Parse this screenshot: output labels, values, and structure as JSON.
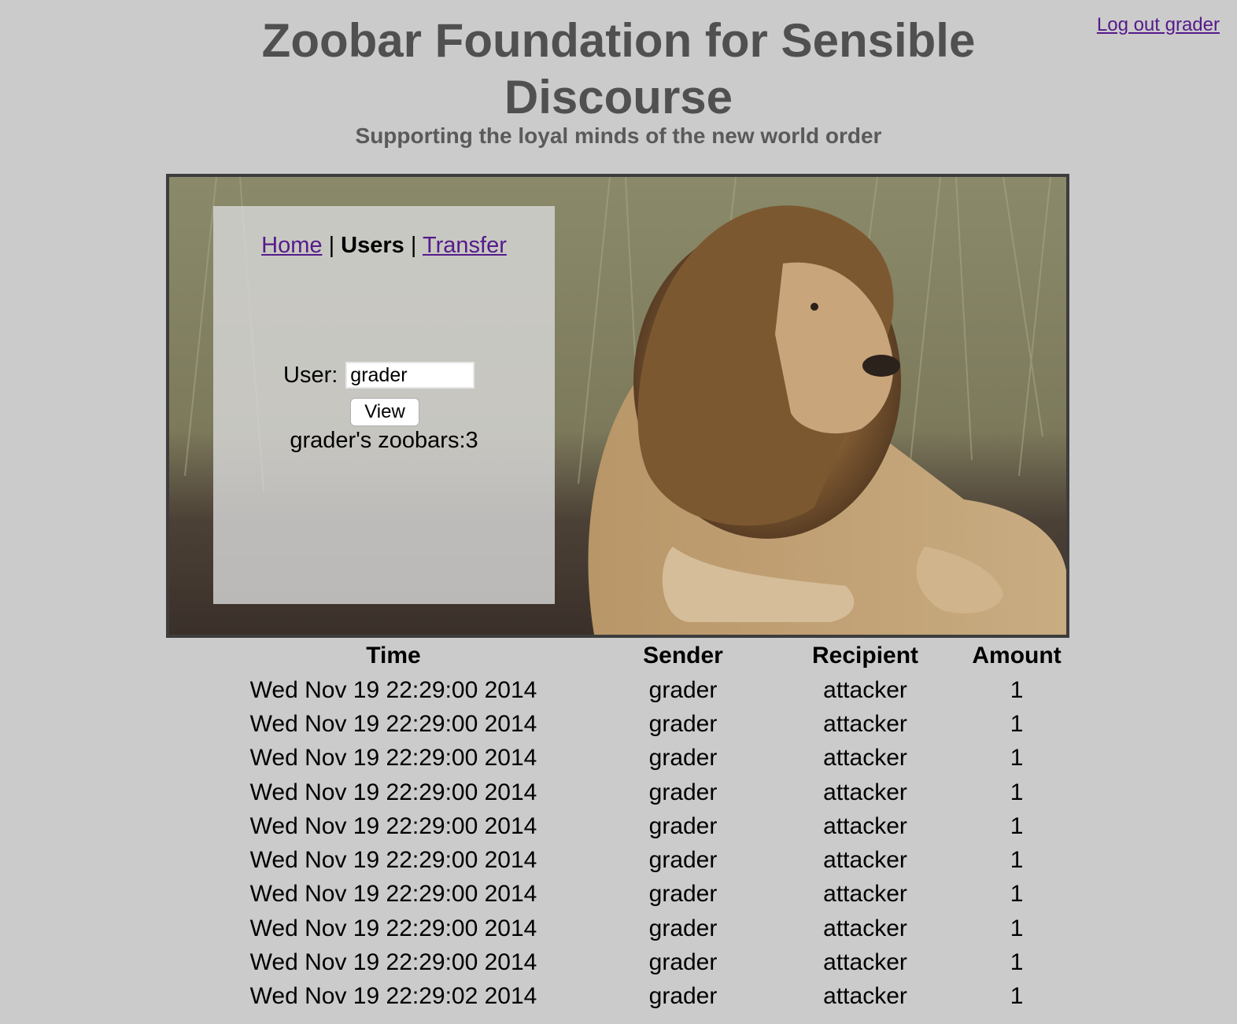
{
  "header": {
    "logout_label": "Log out grader",
    "title_line1": "Zoobar Foundation for Sensible",
    "title_line2": "Discourse",
    "subtitle": "Supporting the loyal minds of the new world order"
  },
  "nav": {
    "home": "Home",
    "separator": "|",
    "users": "Users",
    "transfer": "Transfer"
  },
  "user_form": {
    "label": "User:",
    "value": "grader",
    "view_button": "View",
    "zoobars_text": "grader's zoobars:3"
  },
  "table": {
    "headers": [
      "Time",
      "Sender",
      "Recipient",
      "Amount"
    ],
    "rows": [
      [
        "Wed Nov 19 22:29:00 2014",
        "grader",
        "attacker",
        "1"
      ],
      [
        "Wed Nov 19 22:29:00 2014",
        "grader",
        "attacker",
        "1"
      ],
      [
        "Wed Nov 19 22:29:00 2014",
        "grader",
        "attacker",
        "1"
      ],
      [
        "Wed Nov 19 22:29:00 2014",
        "grader",
        "attacker",
        "1"
      ],
      [
        "Wed Nov 19 22:29:00 2014",
        "grader",
        "attacker",
        "1"
      ],
      [
        "Wed Nov 19 22:29:00 2014",
        "grader",
        "attacker",
        "1"
      ],
      [
        "Wed Nov 19 22:29:00 2014",
        "grader",
        "attacker",
        "1"
      ],
      [
        "Wed Nov 19 22:29:00 2014",
        "grader",
        "attacker",
        "1"
      ],
      [
        "Wed Nov 19 22:29:00 2014",
        "grader",
        "attacker",
        "1"
      ],
      [
        "Wed Nov 19 22:29:02 2014",
        "grader",
        "attacker",
        "1"
      ]
    ]
  },
  "colors": {
    "page_bg": "#cbcbcb",
    "title": "#505050",
    "link": "#551a8b"
  },
  "icons": {
    "banner_image": "lion-photo"
  }
}
